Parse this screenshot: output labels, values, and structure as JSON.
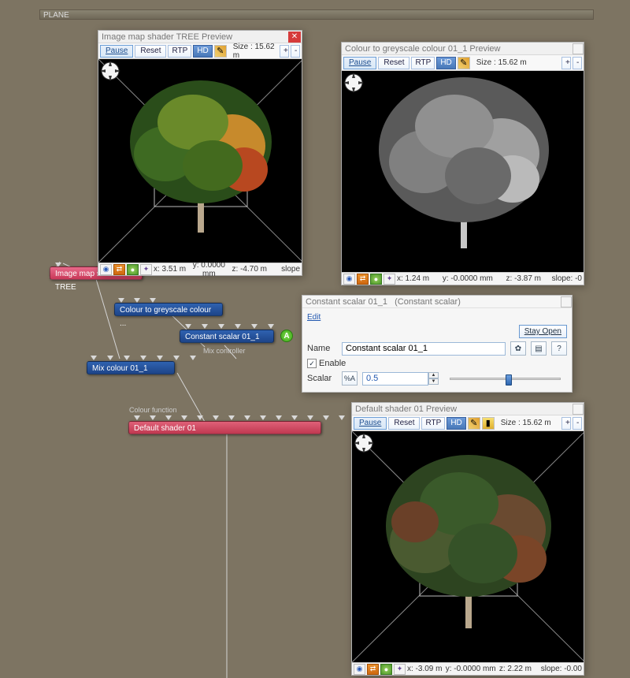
{
  "section": {
    "label": "PLANE"
  },
  "preview_size_label": "Size : 15.62 m",
  "toolbar": {
    "pause": "Pause",
    "reset": "Reset",
    "rtp": "RTP",
    "hd": "HD",
    "plus": "+",
    "minus": "-"
  },
  "panels": {
    "tree": {
      "title": "Image map shader TREE Preview",
      "status": {
        "x": "x: 3.51 m",
        "y": "y: 0.0000 mm",
        "z": "z: -4.70 m",
        "slope": "slope"
      }
    },
    "grey": {
      "title": "Colour to greyscale colour 01_1 Preview",
      "status": {
        "x": "x: 1.24 m",
        "y": "y: -0.0000 mm",
        "z": "z: -3.87 m",
        "slope": "slope: -0"
      }
    },
    "default": {
      "title": "Default shader 01 Preview",
      "status": {
        "x": "x: -3.09 m",
        "y": "y: -0.0000 mm",
        "z": "z: 2.22 m",
        "slope": "slope: -0.00"
      }
    }
  },
  "nodes": {
    "imgmap": "Image map shader TREE",
    "c2g": "Colour to greyscale colour ...",
    "constant": "Constant scalar 01_1",
    "mix_ctrl_label": "Mix controller",
    "mix": "Mix colour 01_1",
    "colour_fn_label": "Colour function",
    "default": "Default shader 01",
    "badge": "A"
  },
  "props": {
    "title_name": "Constant scalar 01_1",
    "title_type": "(Constant scalar)",
    "edit": "Edit",
    "stay_open": "Stay Open",
    "name_label": "Name",
    "name_value": "Constant scalar 01_1",
    "enable": "Enable",
    "scalar_label": "Scalar",
    "scalar_value": "0.5",
    "help": "?"
  }
}
